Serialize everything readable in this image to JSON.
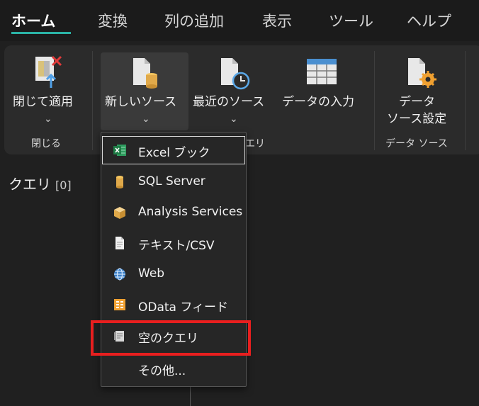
{
  "tabs": [
    {
      "label": "ホーム",
      "active": true
    },
    {
      "label": "変換"
    },
    {
      "label": "列の追加"
    },
    {
      "label": "表示"
    },
    {
      "label": "ツール"
    },
    {
      "label": "ヘルプ"
    }
  ],
  "ribbon": {
    "close_apply": {
      "label": "閉じて適用",
      "chevron": "⌄",
      "group": "閉じる"
    },
    "new_source": {
      "label": "新しいソース",
      "chevron": "⌄"
    },
    "recent_source": {
      "label": "最近のソース",
      "chevron": "⌄"
    },
    "enter_data": {
      "label": "データの入力"
    },
    "query_group_partial": "エリ",
    "datasource_settings": {
      "line1": "データ",
      "line2": "ソース設定",
      "group": "データ ソース"
    }
  },
  "queries": {
    "title": "クエリ",
    "count": "[0]"
  },
  "new_source_menu": {
    "items": [
      {
        "label": "Excel ブック",
        "icon": "excel-icon"
      },
      {
        "label": "SQL Server",
        "icon": "database-icon"
      },
      {
        "label": "Analysis Services",
        "icon": "cube-icon"
      },
      {
        "label": "テキスト/CSV",
        "icon": "document-icon"
      },
      {
        "label": "Web",
        "icon": "globe-icon"
      },
      {
        "label": "OData フィード",
        "icon": "odata-icon"
      },
      {
        "label": "空のクエリ",
        "icon": "blank-query-icon",
        "highlighted": true
      },
      {
        "label": "その他..."
      }
    ]
  },
  "colors": {
    "accent": "#2bb3a6",
    "highlight": "#e81f1f",
    "excel": "#1e7b45",
    "gold": "#e0a94a",
    "orange": "#f0a030"
  }
}
